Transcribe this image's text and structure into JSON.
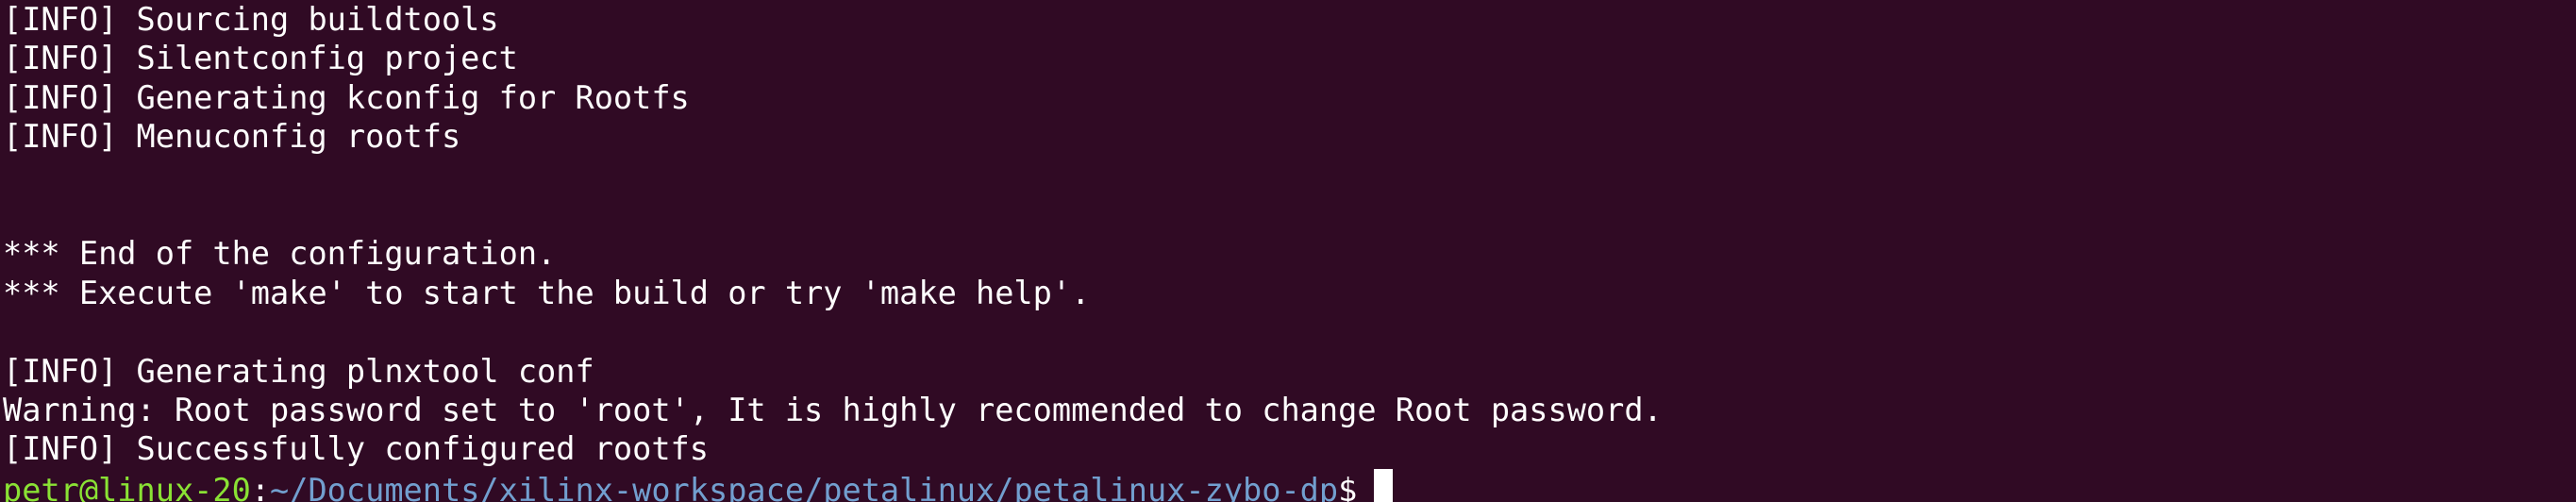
{
  "terminal": {
    "lines": [
      "[INFO] Sourcing buildtools",
      "[INFO] Silentconfig project",
      "[INFO] Generating kconfig for Rootfs",
      "[INFO] Menuconfig rootfs",
      "",
      "",
      "*** End of the configuration.",
      "*** Execute 'make' to start the build or try 'make help'.",
      "",
      "[INFO] Generating plnxtool conf",
      "Warning: Root password set to 'root', It is highly recommended to change Root password.",
      "[INFO] Successfully configured rootfs"
    ],
    "prompt": {
      "user_host": "petr@linux-20",
      "separator": ":",
      "path": "~/Documents/xilinx-workspace/petalinux/petalinux-zybo-dp",
      "symbol": "$"
    },
    "colors": {
      "background": "#300a24",
      "text": "#ffffff",
      "user_host": "#8ae234",
      "path": "#729fcf"
    }
  }
}
